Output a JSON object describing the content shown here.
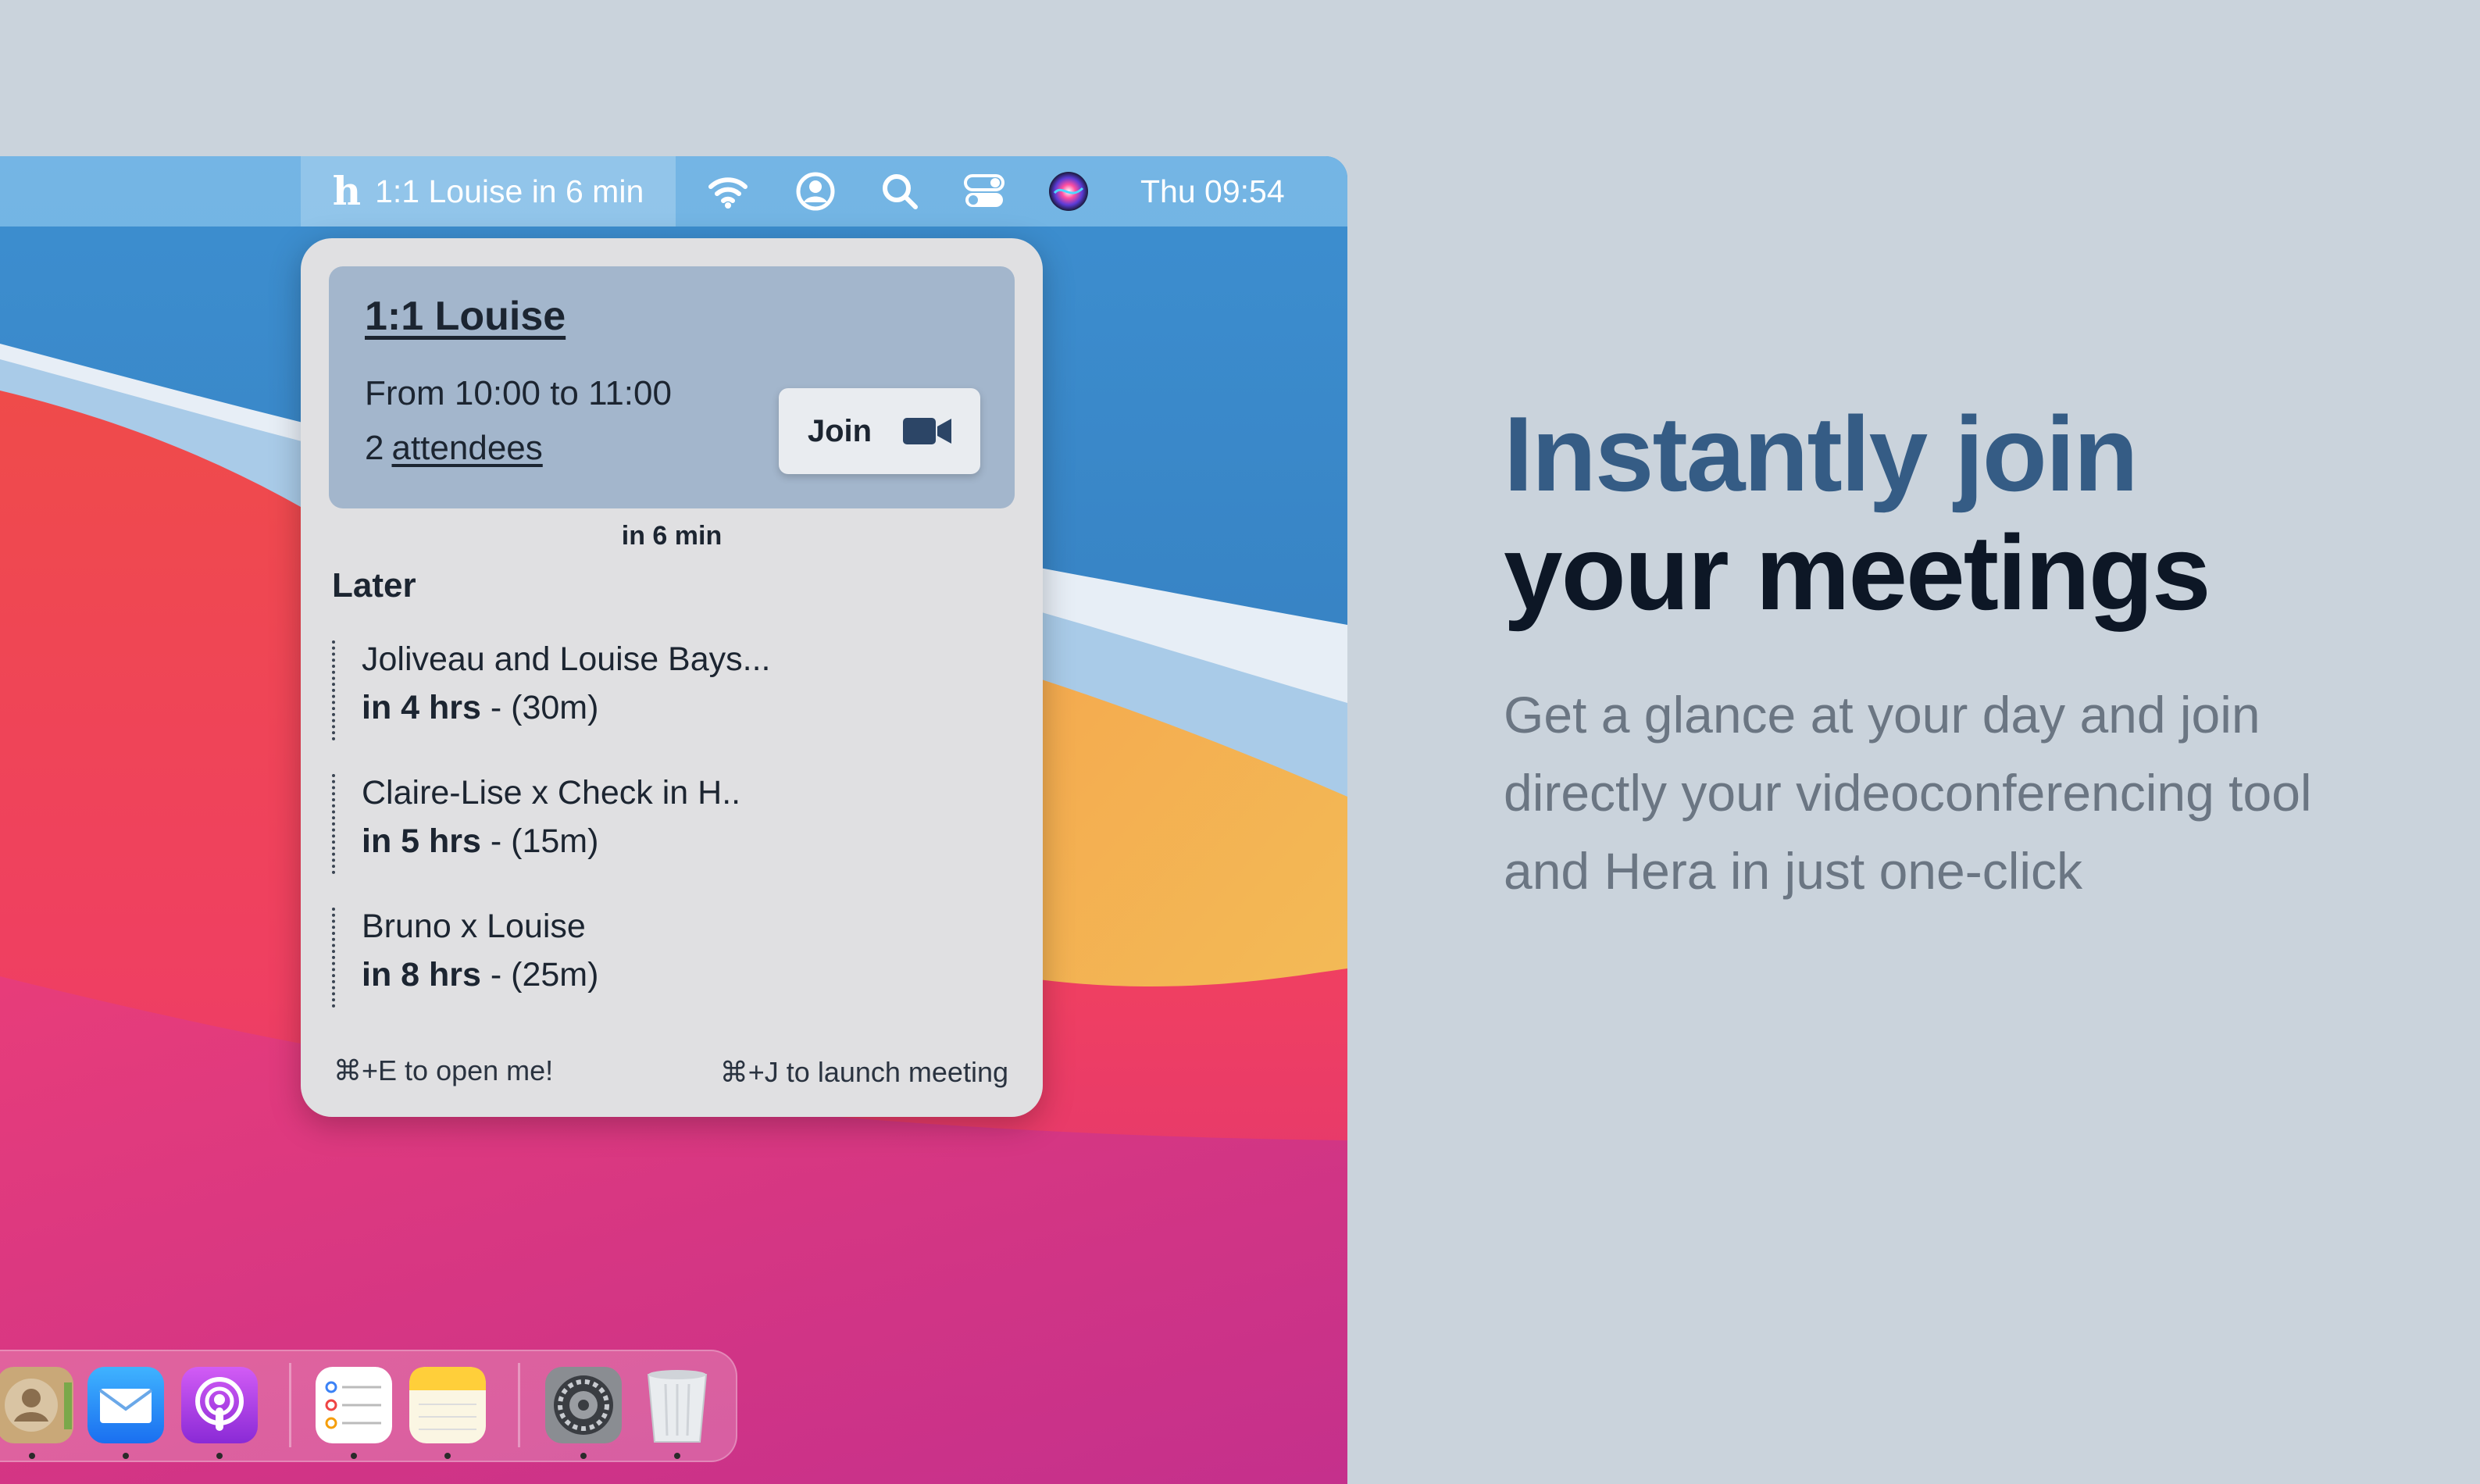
{
  "menubar": {
    "app_status": "1:1 Louise in 6 min",
    "app_logo": "h",
    "clock": "Thu 09:54",
    "icons": [
      "wifi-icon",
      "user-account-icon",
      "search-icon",
      "control-center-icon",
      "siri-icon"
    ]
  },
  "popover": {
    "current_meeting": {
      "title": "1:1 Louise",
      "time": "From 10:00 to 11:00",
      "attendee_count": "2",
      "attendees_label": "attendees",
      "join_label": "Join",
      "countdown": "in 6 min"
    },
    "later_heading": "Later",
    "later_items": [
      {
        "name": "Joliveau and Louise Bays...",
        "when": "in 4 hrs",
        "duration": " - (30m)"
      },
      {
        "name": "Claire-Lise x Check in H..",
        "when": "in 5 hrs",
        "duration": " - (15m)"
      },
      {
        "name": "Bruno x Louise",
        "when": "in 8 hrs",
        "duration": " - (25m)"
      }
    ],
    "hint_open": "⌘+E to open me!",
    "hint_launch": "⌘+J to launch meeting"
  },
  "dock": {
    "apps": [
      "contacts-icon",
      "mail-icon",
      "podcasts-icon",
      "reminders-icon",
      "notes-icon",
      "system-preferences-icon",
      "trash-icon"
    ]
  },
  "marketing": {
    "headline_line1": "Instantly join",
    "headline_line2": "your meetings",
    "subcopy": "Get a glance at your day and join directly your videoconferencing tool and Hera in just one-click"
  },
  "colors": {
    "page_background": "#cad3dc",
    "headline_accent": "#355c85",
    "headline_main": "#0d1726",
    "subcopy": "#6b7683",
    "card": "#a3b6cc",
    "popover": "#e0e0e2"
  }
}
